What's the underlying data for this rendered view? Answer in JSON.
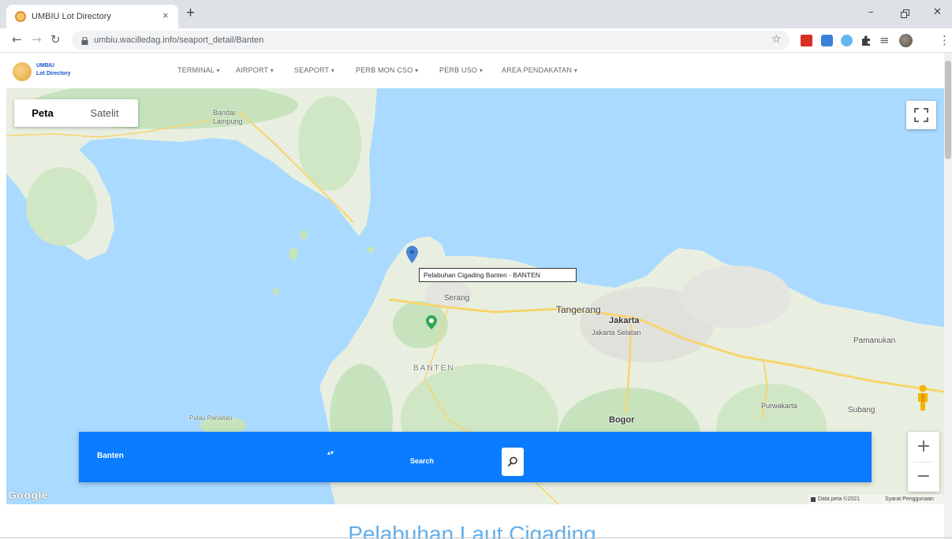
{
  "browser": {
    "tab_title": "UMBIU Lot Directory",
    "url": "umbiu.wacilledag.info/seaport_detail/Banten"
  },
  "icons": {
    "tab_close": "×",
    "new_tab": "+",
    "minimize": "–",
    "close": "✕",
    "back": "←",
    "forward": "→",
    "reload": "↻",
    "star": "☆",
    "media": "≡",
    "menu": "⋮",
    "caret": "▾",
    "select_arrows": "▴▾",
    "zoom_in": "+",
    "zoom_out": "−"
  },
  "nav": {
    "logo_line1": "UMBIU",
    "logo_line2": "Lot Directory",
    "items": [
      {
        "label": "TERMINAL"
      },
      {
        "label": "AIRPORT"
      },
      {
        "label": "SEAPORT"
      },
      {
        "label": "PERB MON CSO"
      },
      {
        "label": "PERB USO"
      },
      {
        "label": "AREA PENDAKATAN"
      }
    ]
  },
  "map": {
    "mode_tabs": [
      {
        "label": "Peta",
        "active": true
      },
      {
        "label": "Satelit",
        "active": false
      }
    ],
    "labels": [
      "Bandar Lampung",
      "Serang",
      "Tangerang",
      "Jakarta",
      "Jakarta Selatan",
      "BANTEN",
      "Bogor",
      "Purwakarta",
      "Subang",
      "Pamanukan",
      "Pulau Panaitan"
    ],
    "marker_tooltip": "Pelabuhan Cigading Banten - BANTEN",
    "google_logo": "Google",
    "attribution": "Data peta ©2021",
    "terms": "Syarat Penggunaan"
  },
  "search": {
    "province": "Banten",
    "label": "Search"
  },
  "page": {
    "heading": "Pelabuhan Laut Cigading"
  },
  "colors": {
    "search_bar": "#0a7cff",
    "water": "#aadaff",
    "land": "#e9efe0",
    "forest": "#c6e3bd",
    "road": "#f6d56e",
    "heading": "#63aee8",
    "marker": "#4a86d8"
  }
}
